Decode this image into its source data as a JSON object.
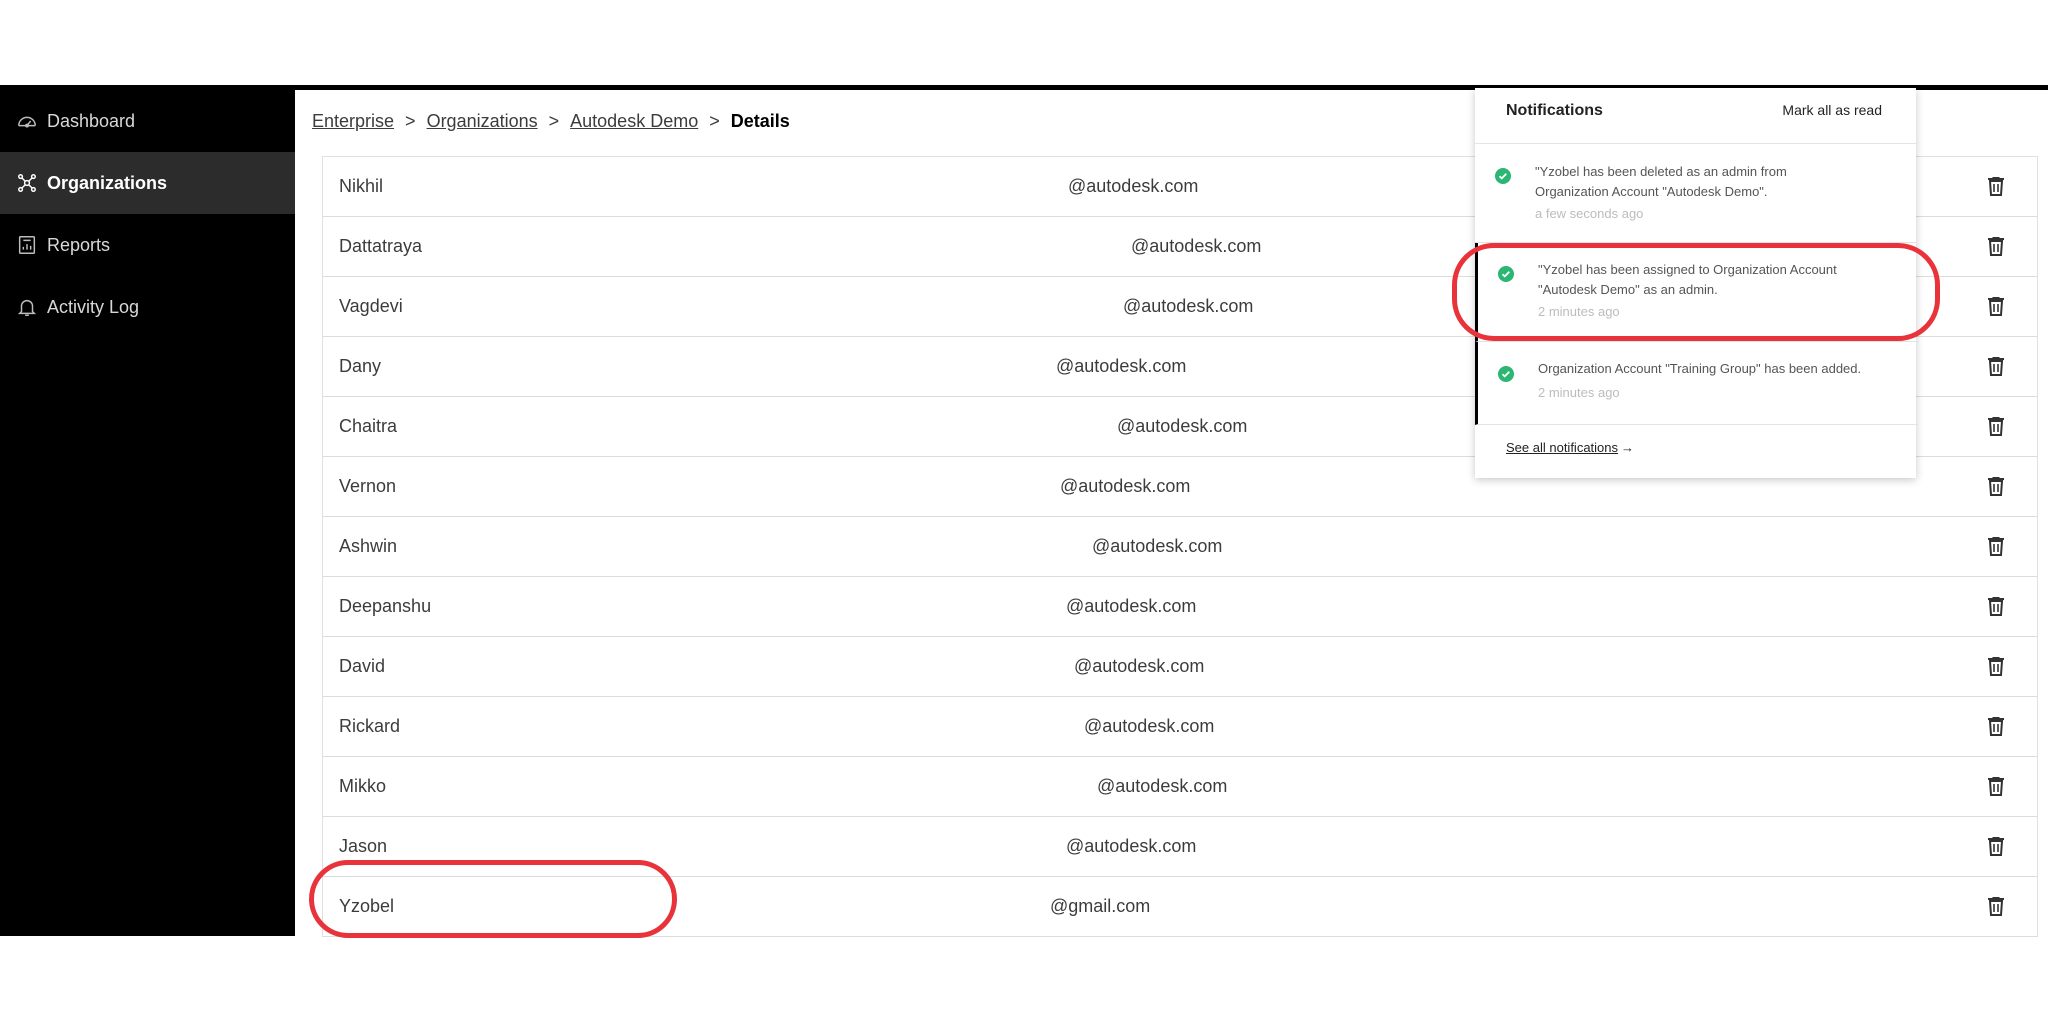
{
  "sidebar": {
    "items": [
      {
        "label": "Dashboard",
        "icon": "dashboard-gauge-icon",
        "active": false
      },
      {
        "label": "Organizations",
        "icon": "organizations-network-icon",
        "active": true
      },
      {
        "label": "Reports",
        "icon": "reports-icon",
        "active": false
      },
      {
        "label": "Activity Log",
        "icon": "bell-icon",
        "active": false
      }
    ]
  },
  "breadcrumb": {
    "items": [
      "Enterprise",
      "Organizations",
      "Autodesk Demo"
    ],
    "separator": ">",
    "current": "Details"
  },
  "table": {
    "rows": [
      {
        "name": "Nikhil",
        "email": "@autodesk.com"
      },
      {
        "name": "Dattatraya",
        "email": "@autodesk.com"
      },
      {
        "name": "Vagdevi",
        "email": "@autodesk.com"
      },
      {
        "name": "Dany",
        "email": "@autodesk.com"
      },
      {
        "name": "Chaitra",
        "email": "@autodesk.com"
      },
      {
        "name": "Vernon",
        "email": "@autodesk.com"
      },
      {
        "name": "Ashwin",
        "email": "@autodesk.com"
      },
      {
        "name": "Deepanshu",
        "email": "@autodesk.com"
      },
      {
        "name": "David",
        "email": "@autodesk.com"
      },
      {
        "name": "Rickard",
        "email": "@autodesk.com"
      },
      {
        "name": "Mikko",
        "email": "@autodesk.com"
      },
      {
        "name": "Jason",
        "email": "@autodesk.com"
      },
      {
        "name": "Yzobel",
        "email": "@gmail.com"
      }
    ]
  },
  "notifications": {
    "title": "Notifications",
    "mark_all_label": "Mark all as read",
    "items": [
      {
        "text_line1": "\"Yzobel           has been deleted as an admin from",
        "text_line2": "Organization Account \"Autodesk Demo\".",
        "time": "a few seconds ago",
        "status": "success"
      },
      {
        "text_line1": "\"Yzobel           has been assigned to Organization Account",
        "text_line2": "\"Autodesk Demo\" as an admin.",
        "time": "2 minutes ago",
        "status": "success"
      },
      {
        "text_line1": "Organization Account \"Training Group\" has been added.",
        "text_line2": "",
        "time": "2 minutes ago",
        "status": "success"
      }
    ],
    "see_all_label": "See all notifications",
    "see_all_arrow": "→"
  },
  "colors": {
    "sidebar_bg": "#000000",
    "sidebar_active": "#2c2c2c",
    "success_green": "#2bb673",
    "highlight_red": "#e8333b"
  }
}
